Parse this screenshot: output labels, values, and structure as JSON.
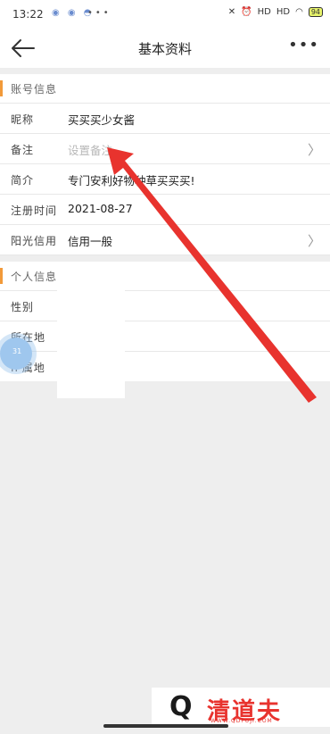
{
  "status_bar": {
    "time": "13:22",
    "app_icons": "◉ ◉ ◓",
    "dots": "•••",
    "signal_1": "HD",
    "signal_2": "HD",
    "battery": "94"
  },
  "nav": {
    "title": "基本资料",
    "more": "•••"
  },
  "account_section": {
    "header": "账号信息",
    "rows": [
      {
        "label": "昵称",
        "value": "买买买少女酱"
      },
      {
        "label": "备注",
        "placeholder": "设置备注"
      },
      {
        "label": "简介",
        "value": "专门安利好物种草买买买!"
      },
      {
        "label": "注册时间",
        "value": "2021-08-27"
      },
      {
        "label": "阳光信用",
        "value": "信用一般"
      }
    ]
  },
  "personal_section": {
    "header": "个人信息",
    "rows": [
      {
        "label": "性别"
      },
      {
        "label": "所在地"
      },
      {
        "label": "IP属地"
      }
    ]
  },
  "floating_button": {
    "label": "31"
  },
  "watermark": {
    "letter": "Q",
    "name": "清道夫",
    "url": "WWW.QDFUJI.COM"
  },
  "colors": {
    "accent": "#f29a3a",
    "arrow": "#e8332e",
    "background": "#eeeeee"
  }
}
